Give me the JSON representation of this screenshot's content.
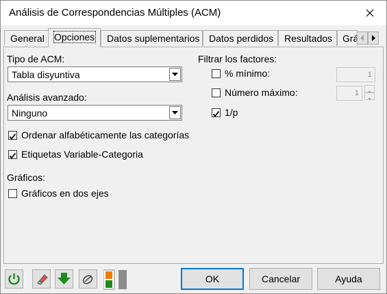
{
  "window": {
    "title": "Análisis de Correspondencias Múltiples (ACM)"
  },
  "tabs": [
    {
      "label": "General"
    },
    {
      "label": "Opciones"
    },
    {
      "label": "Datos suplementarios"
    },
    {
      "label": "Datos perdidos"
    },
    {
      "label": "Resultados"
    },
    {
      "label": "Grá"
    }
  ],
  "options": {
    "tipo_label": "Tipo de ACM:",
    "tipo_value": "Tabla disyuntiva",
    "avanzado_label": "Análisis avanzado:",
    "avanzado_value": "Ninguno",
    "ordenar_label": "Ordenar alfabéticamente las categorías",
    "ordenar_checked": true,
    "etiquetas_label": "Etiquetas Variable-Categoria",
    "etiquetas_checked": true,
    "graficos_label": "Gráficos:",
    "dos_ejes_label": "Gráficos en dos ejes",
    "dos_ejes_checked": false
  },
  "filter": {
    "label": "Filtrar los factores:",
    "minimo_label": "% mínimo:",
    "minimo_checked": false,
    "minimo_value": "1",
    "maximo_label": "Número máximo:",
    "maximo_checked": false,
    "maximo_value": "1",
    "inv_p_label": "1/p",
    "inv_p_checked": true
  },
  "buttons": {
    "ok": "OK",
    "cancel": "Cancelar",
    "help": "Ayuda"
  },
  "colors": {
    "accent": "#0078d7",
    "green": "#1e8a1e",
    "orange": "#f07c00"
  },
  "icons": [
    "reset-icon",
    "eraser-icon",
    "download-arrow-icon",
    "clear-selection-icon",
    "split-view-icon"
  ]
}
